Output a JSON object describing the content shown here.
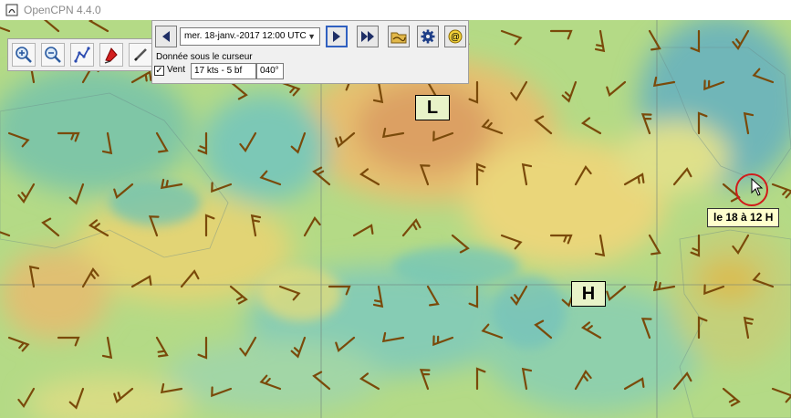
{
  "window": {
    "title": "OpenCPN 4.4.0"
  },
  "grib": {
    "date": "mer. 18-janv.-2017 12:00 UTC",
    "cursor_data_title": "Donnée sous le curseur",
    "wind_label": "Vent",
    "wind_checked": true,
    "wind_speed": "17 kts - 5 bf",
    "wind_direction": "040°"
  },
  "map": {
    "low_label": "L",
    "high_label": "H",
    "tooltip": "le 18 à 12 H",
    "barb_color": "#7a4a0a"
  },
  "toolbar": {
    "icons": [
      "zoom-in-icon",
      "zoom-out-icon",
      "route-icon",
      "ship-icon",
      "pencil-icon"
    ]
  }
}
